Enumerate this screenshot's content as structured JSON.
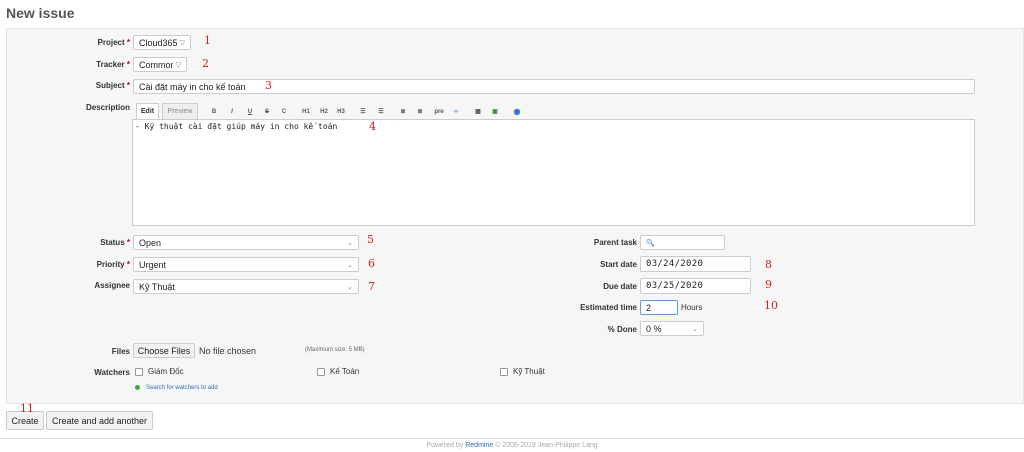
{
  "page": {
    "title": "New issue"
  },
  "form": {
    "project": {
      "label": "Project",
      "required": "*",
      "value": "Cloud365"
    },
    "tracker": {
      "label": "Tracker",
      "required": "*",
      "value": "Common"
    },
    "subject": {
      "label": "Subject",
      "required": "*",
      "value": "Cài đặt máy in cho kế toán"
    },
    "description": {
      "label": "Description",
      "tabs": [
        "Edit",
        "Preview"
      ],
      "toolbar": [
        "B",
        "I",
        "U",
        "S",
        "C",
        "H1",
        "H2",
        "H3",
        "ul-list-icon",
        "ol-list-icon",
        "indent-left-icon",
        "indent-right-icon",
        "pre",
        "code-icon",
        "table-icon",
        "image-icon",
        "help-icon"
      ],
      "value": "- Kỹ thuật cài đặt giúp máy in cho kế toán"
    },
    "status": {
      "label": "Status",
      "required": "*",
      "value": "Open"
    },
    "priority": {
      "label": "Priority",
      "required": "*",
      "value": "Urgent"
    },
    "assignee": {
      "label": "Assignee",
      "value": "Kỹ Thuật"
    },
    "parent_task": {
      "label": "Parent task",
      "value": ""
    },
    "start_date": {
      "label": "Start date",
      "value": "03/24/2020"
    },
    "due_date": {
      "label": "Due date",
      "value": "03/25/2020"
    },
    "estimated_time": {
      "label": "Estimated time",
      "value": "2",
      "unit": "Hours"
    },
    "done": {
      "label": "% Done",
      "value": "0 %"
    },
    "files": {
      "label": "Files",
      "button": "Choose Files",
      "status": "No file chosen",
      "max_size": "(Maximum size: 5 MB)"
    },
    "watchers": {
      "label": "Watchers",
      "items": [
        "Giám Đốc",
        "Kế Toán",
        "Kỹ Thuật"
      ],
      "search_link": "Search for watchers to add"
    }
  },
  "actions": {
    "create": "Create",
    "create_another": "Create and add another"
  },
  "annotations": [
    "1",
    "2",
    "3",
    "4",
    "5",
    "6",
    "7",
    "8",
    "9",
    "10",
    "11"
  ],
  "footer": {
    "prefix": "Powered by",
    "link": "Redmine",
    "suffix": "© 2006-2019 Jean-Philippe Lang"
  },
  "colors": {
    "required": "#bb0000",
    "annotation": "#cc2222",
    "link": "#2a6fb8"
  }
}
